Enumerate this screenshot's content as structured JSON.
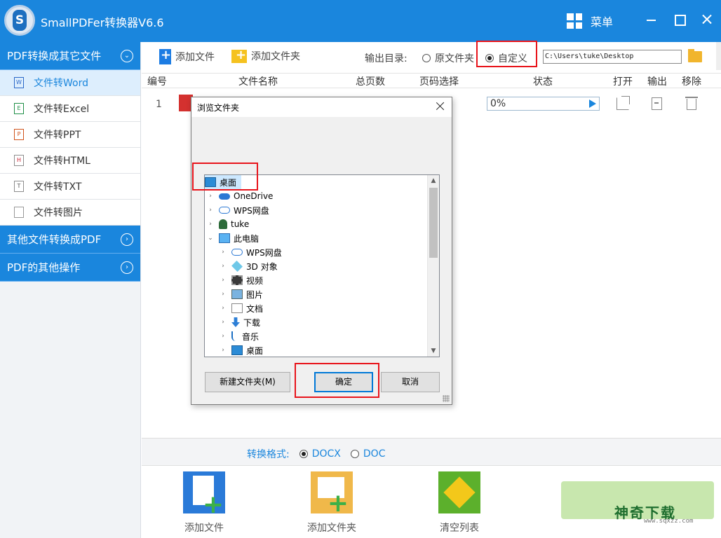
{
  "app": {
    "title": "SmallPDFer转换器V6.6",
    "menu_label": "菜单"
  },
  "sidebar": {
    "group1": "PDF转换成其它文件",
    "items": [
      "文件转Word",
      "文件转Excel",
      "文件转PPT",
      "文件转HTML",
      "文件转TXT",
      "文件转图片"
    ],
    "item_icons": [
      "W",
      "E",
      "P",
      "H",
      "T",
      "img"
    ],
    "group2": "其他文件转换成PDF",
    "group3": "PDF的其他操作"
  },
  "toolbar": {
    "add_file": "添加文件",
    "add_folder": "添加文件夹",
    "output_label": "输出目录:",
    "option_original": "原文件夹",
    "option_custom": "自定义",
    "selected_option": "自定义",
    "path": "C:\\Users\\tuke\\Desktop"
  },
  "table": {
    "headers": [
      "编号",
      "文件名称",
      "总页数",
      "页码选择",
      "状态",
      "打开",
      "输出",
      "移除"
    ],
    "rows": [
      {
        "num": "1",
        "status": "0%",
        "progress": 0
      }
    ]
  },
  "dialog": {
    "title": "浏览文件夹",
    "tree": [
      {
        "label": "桌面",
        "icon": "desktop-icon",
        "level": 0,
        "arrow": "",
        "selected": true
      },
      {
        "label": "OneDrive",
        "icon": "cloud-icon",
        "level": 1,
        "arrow": "›"
      },
      {
        "label": "WPS网盘",
        "icon": "cloud-outline-icon",
        "level": 1,
        "arrow": "›"
      },
      {
        "label": "tuke",
        "icon": "user-icon",
        "level": 1,
        "arrow": "›"
      },
      {
        "label": "此电脑",
        "icon": "computer-icon",
        "level": 1,
        "arrow": "⌄"
      },
      {
        "label": "WPS网盘",
        "icon": "cloud-outline-icon",
        "level": 2,
        "arrow": "›"
      },
      {
        "label": "3D 对象",
        "icon": "cube-icon",
        "level": 2,
        "arrow": "›"
      },
      {
        "label": "视频",
        "icon": "video-icon",
        "level": 2,
        "arrow": "›"
      },
      {
        "label": "图片",
        "icon": "picture-icon",
        "level": 2,
        "arrow": "›"
      },
      {
        "label": "文档",
        "icon": "document-icon",
        "level": 2,
        "arrow": "›"
      },
      {
        "label": "下载",
        "icon": "download-icon",
        "level": 2,
        "arrow": "›"
      },
      {
        "label": "音乐",
        "icon": "music-icon",
        "level": 2,
        "arrow": "›"
      },
      {
        "label": "桌面",
        "icon": "desktop-icon",
        "level": 2,
        "arrow": "›"
      }
    ],
    "new_folder": "新建文件夹(M)",
    "ok": "确定",
    "cancel": "取消"
  },
  "format": {
    "label": "转换格式:",
    "options": [
      "DOCX",
      "DOC"
    ],
    "selected": "DOCX"
  },
  "bottom": {
    "add_file": "添加文件",
    "add_folder": "添加文件夹",
    "clear_list": "清空列表"
  },
  "watermark": {
    "text": "神奇下载",
    "url": "www.sqxzz.com"
  },
  "colors": {
    "accent": "#1a86dd",
    "highlight_box": "#e8141b"
  }
}
